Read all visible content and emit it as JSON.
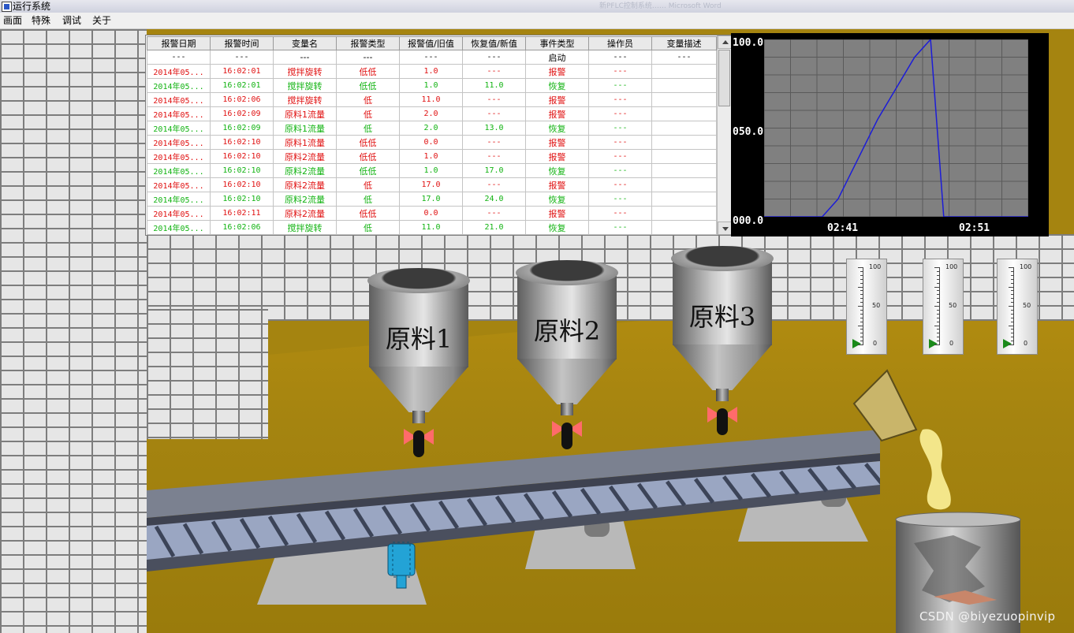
{
  "window": {
    "title": "运行系统",
    "background_title": "新PFLC控制系统…… Microsoft Word"
  },
  "menu": {
    "items": [
      "画面",
      "特殊",
      "调试",
      "关于"
    ]
  },
  "alarm_table": {
    "headers": [
      "报警日期",
      "报警时间",
      "变量名",
      "报警类型",
      "报警值/旧值",
      "恢复值/新值",
      "事件类型",
      "操作员",
      "变量描述"
    ],
    "rows": [
      {
        "kind": "start",
        "cells": [
          "---",
          "---",
          "---",
          "---",
          "---",
          "---",
          "启动",
          "---",
          "---"
        ]
      },
      {
        "kind": "alarm",
        "cells": [
          "2014年05...",
          "16:02:01",
          "搅拌旋转",
          "低低",
          "1.0",
          "---",
          "报警",
          "---",
          ""
        ]
      },
      {
        "kind": "restore",
        "cells": [
          "2014年05...",
          "16:02:01",
          "搅拌旋转",
          "低低",
          "1.0",
          "11.0",
          "恢复",
          "---",
          ""
        ]
      },
      {
        "kind": "alarm",
        "cells": [
          "2014年05...",
          "16:02:06",
          "搅拌旋转",
          "低",
          "11.0",
          "---",
          "报警",
          "---",
          ""
        ]
      },
      {
        "kind": "alarm",
        "cells": [
          "2014年05...",
          "16:02:09",
          "原料1流量",
          "低",
          "2.0",
          "---",
          "报警",
          "---",
          ""
        ]
      },
      {
        "kind": "restore",
        "cells": [
          "2014年05...",
          "16:02:09",
          "原料1流量",
          "低",
          "2.0",
          "13.0",
          "恢复",
          "---",
          ""
        ]
      },
      {
        "kind": "alarm",
        "cells": [
          "2014年05...",
          "16:02:10",
          "原料1流量",
          "低低",
          "0.0",
          "---",
          "报警",
          "---",
          ""
        ]
      },
      {
        "kind": "alarm",
        "cells": [
          "2014年05...",
          "16:02:10",
          "原料2流量",
          "低低",
          "1.0",
          "---",
          "报警",
          "---",
          ""
        ]
      },
      {
        "kind": "restore",
        "cells": [
          "2014年05...",
          "16:02:10",
          "原料2流量",
          "低低",
          "1.0",
          "17.0",
          "恢复",
          "---",
          ""
        ]
      },
      {
        "kind": "alarm",
        "cells": [
          "2014年05...",
          "16:02:10",
          "原料2流量",
          "低",
          "17.0",
          "---",
          "报警",
          "---",
          ""
        ]
      },
      {
        "kind": "restore",
        "cells": [
          "2014年05...",
          "16:02:10",
          "原料2流量",
          "低",
          "17.0",
          "24.0",
          "恢复",
          "---",
          ""
        ]
      },
      {
        "kind": "alarm",
        "cells": [
          "2014年05...",
          "16:02:11",
          "原料2流量",
          "低低",
          "0.0",
          "---",
          "报警",
          "---",
          ""
        ]
      },
      {
        "kind": "restore",
        "cells": [
          "2014年05...",
          "16:02:06",
          "搅拌旋转",
          "低",
          "11.0",
          "21.0",
          "恢复",
          "---",
          ""
        ]
      }
    ],
    "colors": {
      "alarm": "#e01010",
      "restore": "#12b312"
    }
  },
  "trend": {
    "y_labels": [
      "100.0",
      "050.0",
      "000.0"
    ],
    "x_labels": [
      "02:41",
      "02:51"
    ],
    "line_color": "#1c1cd8",
    "grid_color": "#5a5a5a",
    "plot_bg": "#808080"
  },
  "chart_data": {
    "type": "line",
    "ylim": [
      0,
      100
    ],
    "x_tick_labels": [
      "02:41",
      "02:51"
    ],
    "series": [
      {
        "values_pct_time": [
          0,
          22,
          28,
          43,
          57,
          63,
          68,
          100
        ],
        "values": [
          0,
          0,
          10,
          55,
          90,
          100,
          0,
          0
        ]
      }
    ],
    "grid": true
  },
  "hoppers": [
    {
      "label": "原料1"
    },
    {
      "label": "原料2"
    },
    {
      "label": "原料3"
    }
  ],
  "gauges": [
    {
      "top": "100",
      "mid": "50",
      "bottom": "0"
    },
    {
      "top": "100",
      "mid": "50",
      "bottom": "0"
    },
    {
      "top": "100",
      "mid": "50",
      "bottom": "0"
    }
  ],
  "watermark": "CSDN @biyezuopinvip"
}
